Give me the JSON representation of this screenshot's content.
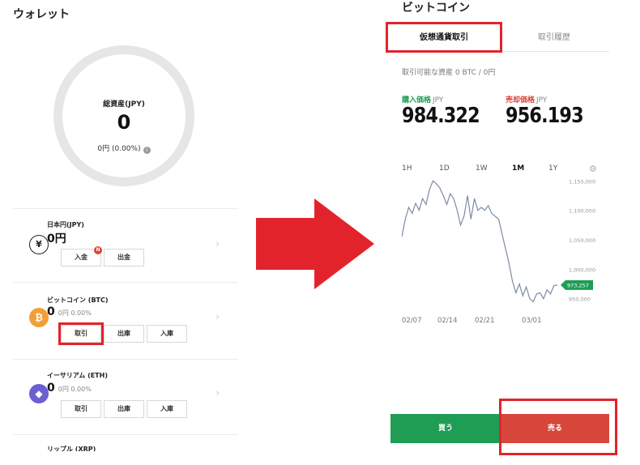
{
  "wallet": {
    "title": "ウォレット",
    "total_label": "総資産(JPY)",
    "total_value": "0",
    "total_sub": "0円 (0.00%)",
    "info_icon": "info-icon",
    "assets": [
      {
        "name": "日本円(JPY)",
        "amount": "0円",
        "sub": "",
        "icon": "yen-icon",
        "icon_glyph": "¥",
        "buttons": [
          "入金",
          "出金"
        ],
        "badge": "N"
      },
      {
        "name": "ビットコイン (BTC)",
        "amount": "0",
        "sub": "0円 0.00%",
        "icon": "bitcoin-icon",
        "icon_glyph": "₿",
        "buttons": [
          "取引",
          "出庫",
          "入庫"
        ]
      },
      {
        "name": "イーサリアム (ETH)",
        "amount": "0",
        "sub": "0円 0.00%",
        "icon": "ethereum-icon",
        "icon_glyph": "◆",
        "buttons": [
          "取引",
          "出庫",
          "入庫"
        ]
      }
    ],
    "partial_next_item": "リップル (XRP)"
  },
  "arrow_icon": "arrow-right-icon",
  "bitcoin": {
    "title": "ビットコイン",
    "tabs": [
      "仮想通貨取引",
      "取引履歴"
    ],
    "available": "取引可能な資産 0 BTC / 0円",
    "buy_label": "購入価格",
    "sell_label": "売却価格",
    "unit": "JPY",
    "buy_price": "984.322",
    "sell_price": "956.193",
    "ranges": [
      "1H",
      "1D",
      "1W",
      "1M",
      "1Y"
    ],
    "active_range": "1M",
    "settings_icon": "gear-icon",
    "buy_button": "買う",
    "sell_button": "売る"
  },
  "colors": {
    "buy_green": "#1f9d55",
    "sell_red": "#d8453b",
    "highlight_red": "#e3232b",
    "bitcoin_orange": "#f0a035",
    "ethereum_purple": "#6b5fd3",
    "chart_line": "#7c8ba6"
  },
  "chart_data": {
    "type": "line",
    "x_ticks": [
      "02/07",
      "02/14",
      "02/21",
      "03/01"
    ],
    "y_ticks": [
      "1,150,000",
      "1,100,000",
      "1,050,000",
      "1,000,000",
      "950,000"
    ],
    "ylim": [
      940000,
      1160000
    ],
    "current_value_label": "973,257",
    "current_value": 973257,
    "grid": false,
    "series": [
      {
        "values": [
          1055000,
          1085000,
          1105000,
          1095000,
          1112000,
          1100000,
          1120000,
          1110000,
          1135000,
          1150000,
          1145000,
          1138000,
          1125000,
          1110000,
          1128000,
          1120000,
          1100000,
          1075000,
          1090000,
          1125000,
          1085000,
          1120000,
          1100000,
          1105000,
          1100000,
          1108000,
          1095000,
          1090000,
          1085000,
          1060000,
          1035000,
          1010000,
          980000,
          960000,
          975000,
          955000,
          970000,
          950000,
          945000,
          958000,
          960000,
          950000,
          965000,
          958000,
          972000,
          973257
        ]
      }
    ]
  }
}
